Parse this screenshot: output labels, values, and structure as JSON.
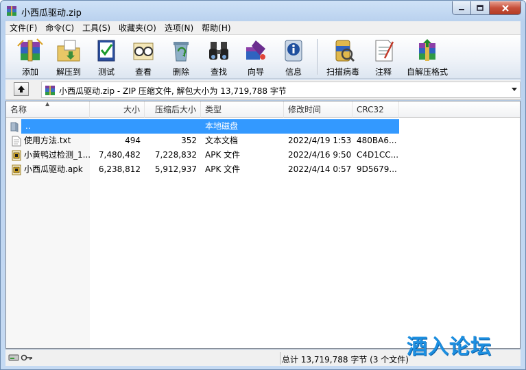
{
  "window": {
    "title": "小西瓜驱动.zip"
  },
  "menu": [
    "文件(F)",
    "命令(C)",
    "工具(S)",
    "收藏夹(O)",
    "选项(N)",
    "帮助(H)"
  ],
  "toolbar": {
    "add": "添加",
    "extract_to": "解压到",
    "test": "测试",
    "view": "查看",
    "delete": "删除",
    "find": "查找",
    "wizard": "向导",
    "info": "信息",
    "virus_scan": "扫描病毒",
    "comment": "注释",
    "sfx": "自解压格式"
  },
  "address": {
    "text": "小西瓜驱动.zip - ZIP 压缩文件, 解包大小为 13,719,788 字节"
  },
  "columns": {
    "name": "名称",
    "size": "大小",
    "packed": "压缩后大小",
    "type": "类型",
    "modified": "修改时间",
    "crc": "CRC32"
  },
  "rows": [
    {
      "name": "..",
      "size": "",
      "packed": "",
      "type": "本地磁盘",
      "modified": "",
      "crc": "",
      "icon": "folder-up-icon",
      "selected": true
    },
    {
      "name": "使用方法.txt",
      "size": "494",
      "packed": "352",
      "type": "文本文档",
      "modified": "2022/4/19 1:53",
      "crc": "480BA6...",
      "icon": "text-file-icon"
    },
    {
      "name": "小黄鸭过检测_1....",
      "size": "7,480,482",
      "packed": "7,228,832",
      "type": "APK 文件",
      "modified": "2022/4/16 9:50",
      "crc": "C4D1CC...",
      "icon": "apk-file-icon"
    },
    {
      "name": "小西瓜驱动.apk",
      "size": "6,238,812",
      "packed": "5,912,937",
      "type": "APK 文件",
      "modified": "2022/4/14 0:57",
      "crc": "9D5679...",
      "icon": "apk-file-icon"
    }
  ],
  "status": {
    "text": "总计 13,719,788 字节 (3 个文件)"
  },
  "watermark": "酒入论坛"
}
